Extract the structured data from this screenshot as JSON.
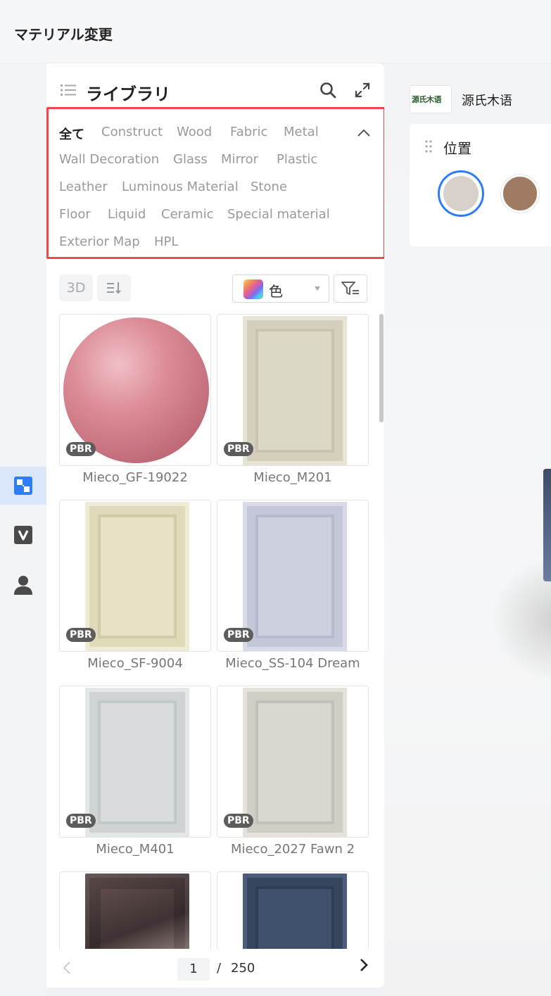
{
  "page": {
    "title": "マテリアル変更"
  },
  "library": {
    "title": "ライブラリ",
    "categories": [
      "全て",
      "Construct",
      "Wood",
      "Fabric",
      "Metal",
      "Wall Decoration",
      "Glass",
      "Mirror",
      "Plastic",
      "Leather",
      "Luminous Material",
      "Stone",
      "Floor",
      "Liquid",
      "Ceramic",
      "Special material",
      "Exterior Map",
      "HPL"
    ],
    "selected_category": "全て",
    "toolbar": {
      "view_3d_label": "3D",
      "color_filter_label": "色"
    },
    "badge": "PBR",
    "materials": [
      {
        "name": "Mieco_GF-19022",
        "color": "#d88a94"
      },
      {
        "name": "Mieco_M201",
        "color": "#dcd8c6"
      },
      {
        "name": "Mieco_SF-9004",
        "color": "#e7e2c6"
      },
      {
        "name": "Mieco_SS-104 Dream",
        "color": "#ccd0df"
      },
      {
        "name": "Mieco_M401",
        "color": "#d8dcdc"
      },
      {
        "name": "Mieco_2027 Fawn 2",
        "color": "#d9d7cf"
      },
      {
        "name": "",
        "color": "#5a4a4a"
      },
      {
        "name": "",
        "color": "#3f506b"
      }
    ],
    "pagination": {
      "current": "1",
      "separator": "/",
      "total": "250"
    }
  },
  "right_panel": {
    "brand_logo_text": "源氏木语",
    "brand_name": "源氏木语",
    "position_label": "位置",
    "swatches": [
      "#d8d1cb",
      "#a07b63"
    ]
  }
}
